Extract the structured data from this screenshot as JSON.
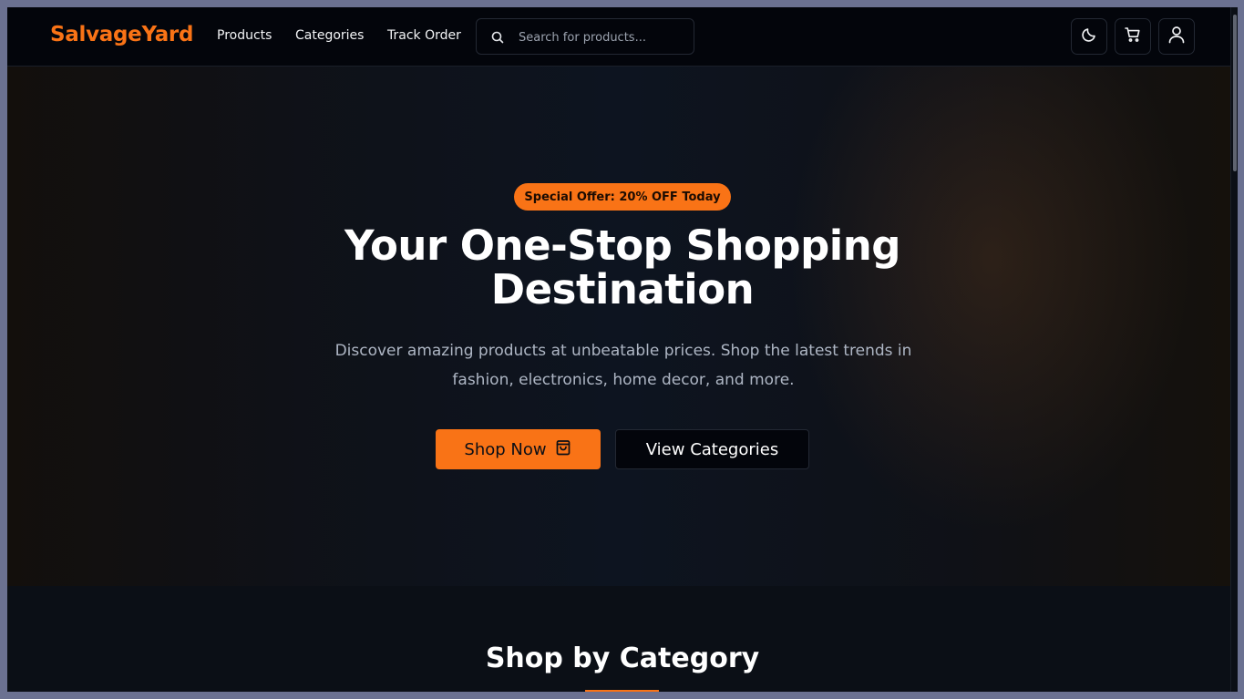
{
  "header": {
    "logo": "SalvageYard",
    "nav": [
      "Products",
      "Categories",
      "Track Order"
    ],
    "search_placeholder": "Search for products..."
  },
  "icons": {
    "search": "search-icon",
    "theme": "moon-icon",
    "cart": "cart-icon",
    "user": "user-icon",
    "shop_bag": "shopping-bag-icon"
  },
  "hero": {
    "badge": "Special Offer: 20% OFF Today",
    "title_line1": "Your One-Stop Shopping",
    "title_line2": "Destination",
    "description": "Discover amazing products at unbeatable prices. Shop the latest trends in fashion, electronics, home decor, and more.",
    "primary_button": "Shop Now",
    "secondary_button": "View Categories"
  },
  "section": {
    "title": "Shop by Category"
  },
  "colors": {
    "accent": "#f97316",
    "background": "#0b0f16",
    "header": "#03050b"
  }
}
